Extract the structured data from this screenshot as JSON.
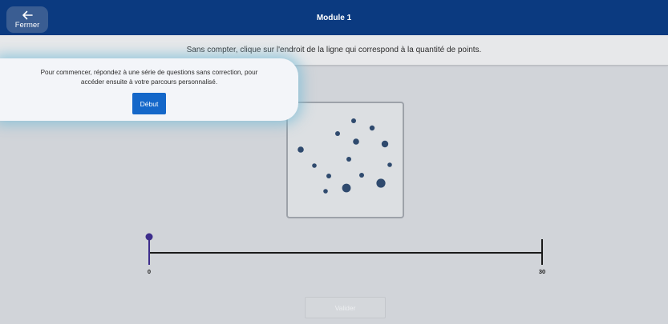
{
  "header": {
    "close_label": "Fermer",
    "title": "Module 1",
    "close_icon": "arrow-left-icon",
    "colors": {
      "bar": "#0b3a80",
      "close_button": "#3a5d92"
    }
  },
  "instruction": "Sans compter, clique sur l'endroit de la ligne qui correspond à la quantité de points.",
  "popup": {
    "text": "Pour commencer, répondez à une série de questions sans correction, pour accéder ensuite à votre parcours personnalisé.",
    "button_label": "Début",
    "colors": {
      "button": "#1467c9",
      "glow": "#7dbed7"
    }
  },
  "dots": {
    "count": 14,
    "color": "#2f4a6e"
  },
  "number_line": {
    "min_label": "0",
    "max_label": "30",
    "min": 0,
    "max": 30,
    "marker_value": 0,
    "marker_color": "#3d2d8c"
  },
  "validate_label": "Valider"
}
